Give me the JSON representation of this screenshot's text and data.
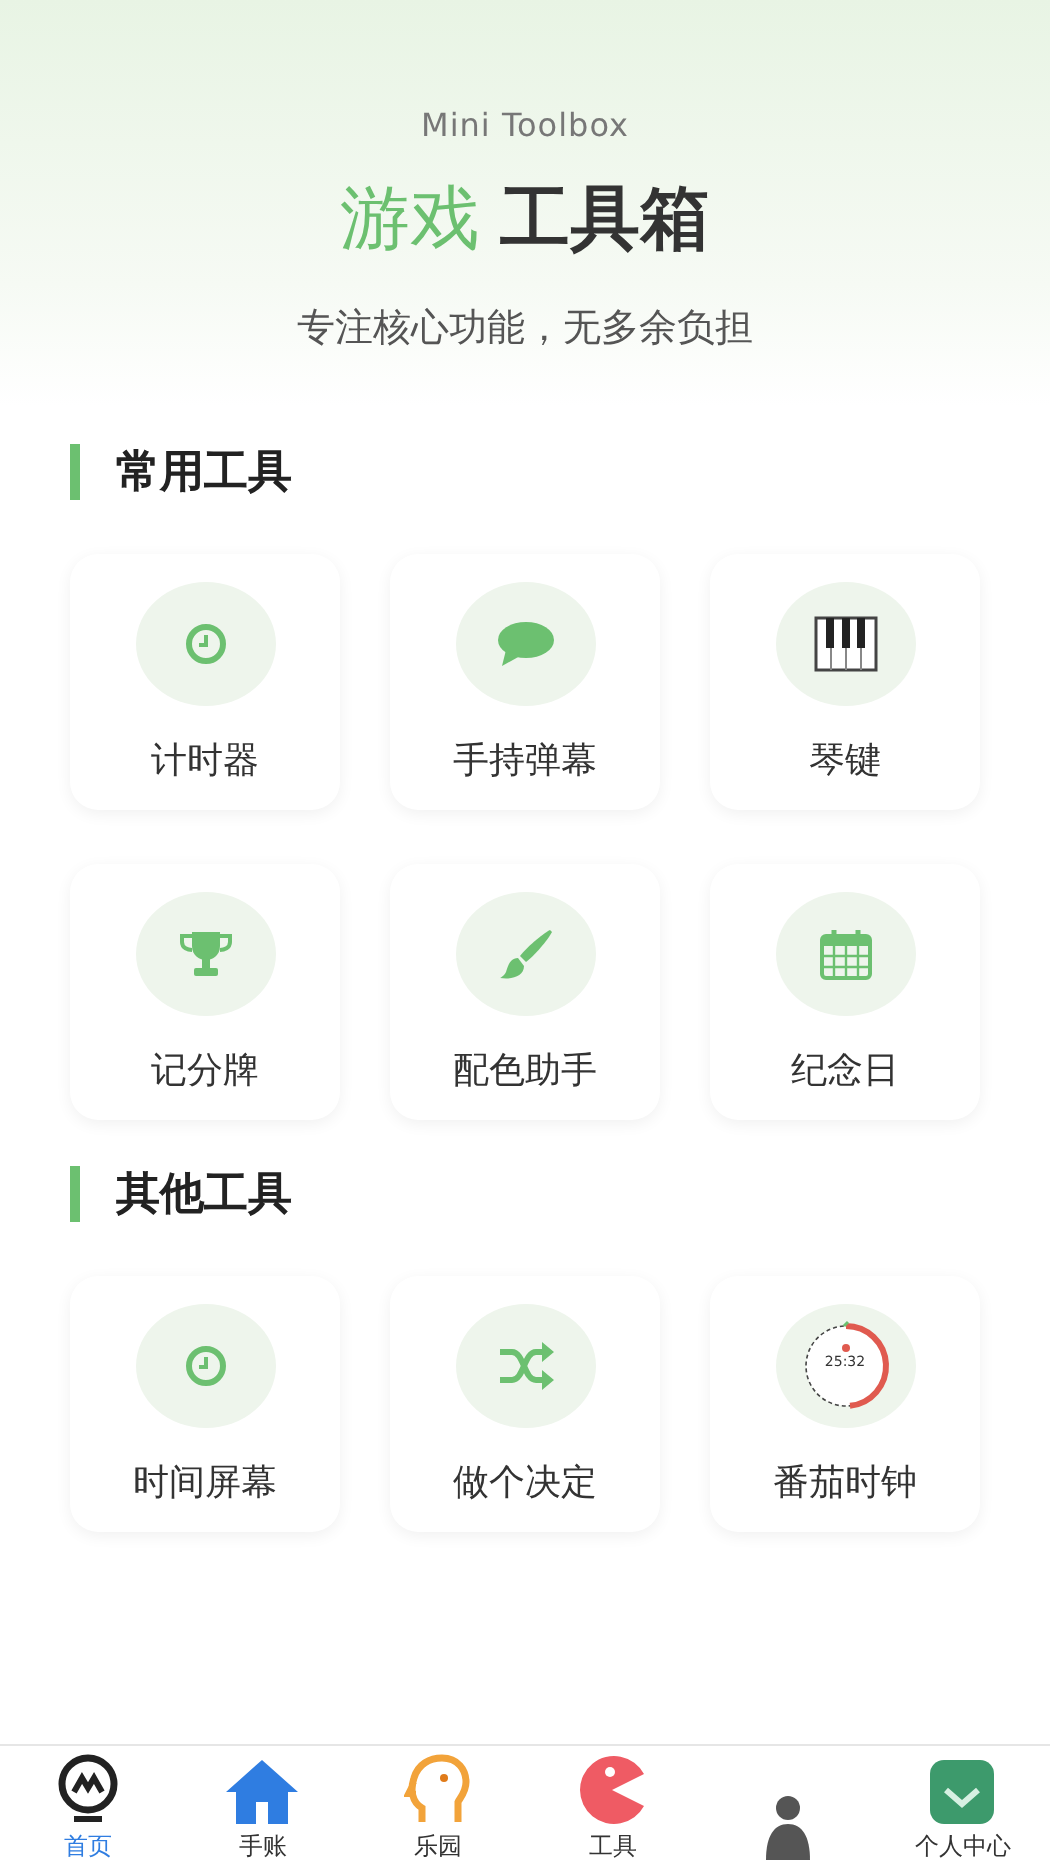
{
  "header": {
    "subtitle_en": "Mini Toolbox",
    "title_accent": "游戏",
    "title_main": "工具箱",
    "tagline": "专注核心功能，无多余负担"
  },
  "sections": [
    {
      "title": "常用工具",
      "tools": [
        {
          "label": "计时器",
          "kind": "clock"
        },
        {
          "label": "手持弹幕",
          "kind": "chat"
        },
        {
          "label": "琴键",
          "kind": "piano"
        },
        {
          "label": "记分牌",
          "kind": "trophy"
        },
        {
          "label": "配色助手",
          "kind": "brush"
        },
        {
          "label": "纪念日",
          "kind": "calendar"
        }
      ]
    },
    {
      "title": "其他工具",
      "tools": [
        {
          "label": "时间屏幕",
          "kind": "clock"
        },
        {
          "label": "做个决定",
          "kind": "shuffle"
        },
        {
          "label": "番茄时钟",
          "kind": "pomodoro",
          "icon_text": "25:32"
        }
      ]
    }
  ],
  "bottom_nav": [
    {
      "label": "首页",
      "kind": "bulb",
      "selected": true
    },
    {
      "label": "手账",
      "kind": "house",
      "selected": false
    },
    {
      "label": "乐园",
      "kind": "head",
      "selected": false
    },
    {
      "label": "工具",
      "kind": "pacman",
      "selected": false
    },
    {
      "kind": "figure",
      "selected": false
    },
    {
      "label": "个人中心",
      "kind": "badge",
      "selected": false
    }
  ]
}
